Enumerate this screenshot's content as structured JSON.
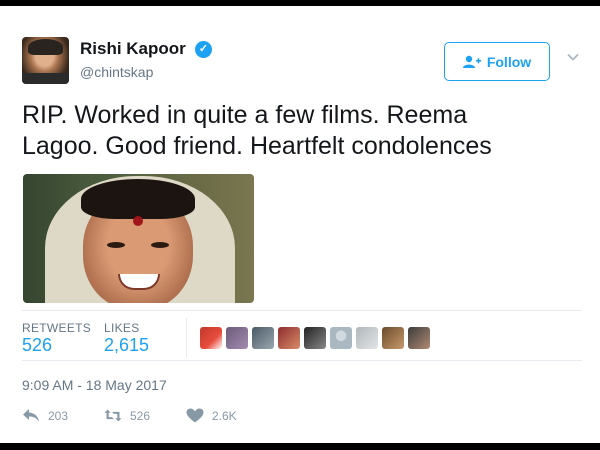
{
  "author": {
    "name": "Rishi Kapoor",
    "handle": "@chintskap",
    "verified_icon": "verified-badge-icon"
  },
  "follow_button": {
    "label": "Follow",
    "icon": "add-user-icon"
  },
  "tweet": {
    "text_line1": "RIP. Worked in quite a few films. Reema",
    "text_line2": "Lagoo. Good friend. Heartfelt condolences"
  },
  "stats": {
    "retweets_label": "RETWEETS",
    "retweets_value": "526",
    "likes_label": "LIKES",
    "likes_value": "2,615"
  },
  "timestamp": "9:09 AM - 18 May 2017",
  "actions": {
    "reply_count": "203",
    "retweet_count": "526",
    "like_count": "2.6K"
  },
  "colors": {
    "accent": "#1da1f2",
    "muted": "#657786",
    "text": "#14171a"
  }
}
